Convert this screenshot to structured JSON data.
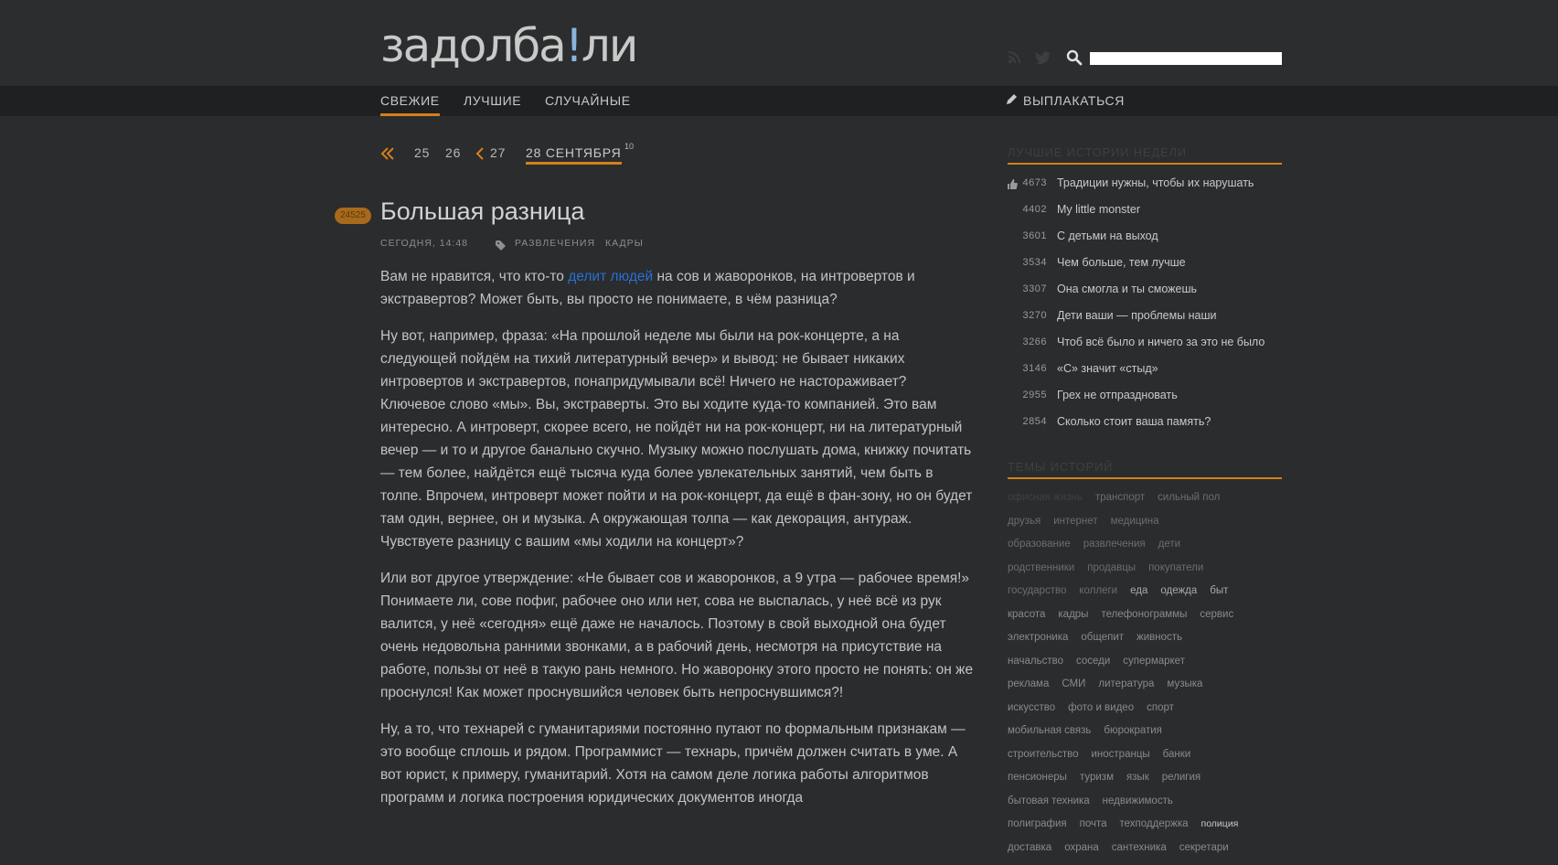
{
  "header": {
    "logo_main": "задолба",
    "logo_bang": "!",
    "logo_end": "ли",
    "search_placeholder": ""
  },
  "nav": {
    "fresh": "СВЕЖИЕ",
    "best": "ЛУЧШИЕ",
    "random": "СЛУЧАЙНЫЕ",
    "cry": "ВЫПЛАКАТЬСЯ"
  },
  "pager": {
    "d25": "25",
    "d26": "26",
    "d27": "27",
    "current": "28 СЕНТЯБРЯ",
    "current_count": "10"
  },
  "story": {
    "rating": "24525",
    "title": "Большая разница",
    "date": "СЕГОДНЯ, 14:48",
    "tag1": "РАЗВЛЕЧЕНИЯ",
    "tag2": "КАДРЫ",
    "p1_a": "Вам не нравится, что кто-то ",
    "p1_link": "делит людей",
    "p1_b": " на сов и жаворонков, на интровертов и экстравертов? Может быть, вы просто не понимаете, в чём разница?",
    "p2": "Ну вот, например, фраза: «На прошлой неделе мы были на рок-концерте, а на следующей пойдём на тихий литературный вечер» и вывод: не бывает никаких интровертов и экстравертов, понапридумывали всё! Ничего не настораживает? Ключевое слово «мы». Вы, экстраверты. Это вы ходите куда-то компанией. Это вам интересно. А интроверт, скорее всего, не пойдёт ни на рок-концерт, ни на литературный вечер — и то и другое банально скучно. Музыку можно послушать дома, книжку почитать — тем более, найдётся ещё тысяча куда более увлекательных занятий, чем быть в толпе. Впрочем, интроверт может пойти и на рок-концерт, да ещё в фан-зону, но он будет там один, вернее, он и музыка. А окружающая толпа — как декорация, антураж. Чувствуете разницу с вашим «мы ходили на концерт»?",
    "p3": "Или вот другое утверждение: «Не бывает сов и жаворонков, а 9 утра — рабочее время!» Понимаете ли, сове пофиг, рабочее оно или нет, сова не выспалась, у неё всё из рук валится, у неё «сегодня» ещё даже не началось. Поэтому в свой выходной она будет очень недовольна ранними звонками, а в рабочий день, несмотря на присутствие на работе, пользы от неё в такую рань немного. Но жаворонку этого просто не понять: он же проснулся! Как может проснувшийся человек быть непроснувшимся?!",
    "p4": "Ну, а то, что технарей с гуманитариями постоянно путают по формальным признакам — это вообще сплошь и рядом. Программист — технарь, причём должен считать в уме. А вот юрист, к примеру, гуманитарий. Хотя на самом деле логика работы алгоритмов программ и логика построения юридических документов иногда"
  },
  "sidebar": {
    "best_heading": "ЛУЧШИЕ ИСТОРИИ НЕДЕЛИ",
    "best": [
      {
        "count": "4673",
        "title": "Традиции нужны, чтобы их нарушать"
      },
      {
        "count": "4402",
        "title": "My little monster"
      },
      {
        "count": "3601",
        "title": "С детьми на выход"
      },
      {
        "count": "3534",
        "title": "Чем больше, тем лучше"
      },
      {
        "count": "3307",
        "title": "Она смогла и ты сможешь"
      },
      {
        "count": "3270",
        "title": "Дети ваши — проблемы наши"
      },
      {
        "count": "3266",
        "title": "Чтоб всё было и ничего за это не было"
      },
      {
        "count": "3146",
        "title": "«С» значит «стыд»"
      },
      {
        "count": "2955",
        "title": "Грех не отпраздновать"
      },
      {
        "count": "2854",
        "title": "Сколько стоит ваша память?"
      }
    ],
    "topics_heading": "ТЕМЫ ИСТОРИЙ",
    "tags": [
      [
        "офисная жизнь",
        "транспорт",
        "сильный пол"
      ],
      [
        "друзья",
        "интернет",
        "медицина"
      ],
      [
        "образование",
        "развлечения",
        "дети"
      ],
      [
        "родственники",
        "продавцы",
        "покупатели"
      ],
      [
        "государство",
        "коллеги",
        "еда",
        "одежда",
        "быт"
      ],
      [
        "красота",
        "кадры",
        "телефонограммы",
        "сервис"
      ],
      [
        "электроника",
        "общепит",
        "живность"
      ],
      [
        "начальство",
        "соседи",
        "супермаркет"
      ],
      [
        "реклама",
        "СМИ",
        "литература",
        "музыка"
      ],
      [
        "искусство",
        "фото и видео",
        "спорт"
      ],
      [
        "мобильная связь",
        "бюрократия"
      ],
      [
        "строительство",
        "иностранцы",
        "банки"
      ],
      [
        "пенсионеры",
        "туризм",
        "язык",
        "религия"
      ],
      [
        "бытовая техника",
        "недвижимость"
      ],
      [
        "полиграфия",
        "почта",
        "техподдержка",
        "полиция"
      ],
      [
        "доставка",
        "охрана",
        "сантехника",
        "секретари"
      ]
    ]
  }
}
